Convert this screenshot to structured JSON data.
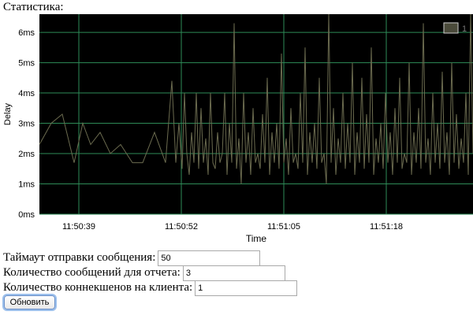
{
  "page": {
    "heading": "Статистика:"
  },
  "form": {
    "timeout_label": "Таймаут отправки сообщения:",
    "timeout_value": "50",
    "report_count_label": "Количество сообщений для отчета:",
    "report_count_value": "3",
    "connections_label": "Количество коннекшенов на клиента:",
    "connections_value": "1",
    "refresh_label": "Обновить"
  },
  "colors": {
    "plot_background": "#000000",
    "grid": "#2e8b57",
    "series_line": "#6b6b4f",
    "legend_swatch": "#4a4a3a",
    "button_focus": "#9cc0ec"
  },
  "chart_data": {
    "type": "line",
    "title": "",
    "xlabel": "Time",
    "ylabel": "Delay",
    "y_ticks": [
      "0ms",
      "1ms",
      "2ms",
      "3ms",
      "4ms",
      "5ms",
      "6ms"
    ],
    "ylim": [
      0,
      6.6
    ],
    "y_unit": "ms",
    "x_ticks": [
      "11:50:39",
      "11:50:52",
      "11:51:05",
      "11:51:18"
    ],
    "x_tick_seconds": [
      39,
      52,
      65,
      78
    ],
    "xlim_seconds": [
      34,
      89
    ],
    "grid": true,
    "legend_position": "top-right",
    "series": [
      {
        "name": "1",
        "x_seconds": [
          34.0,
          35.5,
          36.9,
          38.4,
          39.5,
          40.5,
          41.7,
          43.0,
          44.3,
          45.8,
          47.1,
          48.6,
          50.0,
          50.8,
          51.3,
          51.7,
          52.1,
          52.4,
          52.7,
          53.0,
          53.3,
          53.6,
          53.9,
          54.2,
          54.5,
          54.8,
          55.1,
          55.4,
          55.7,
          56.0,
          56.3,
          56.6,
          56.9,
          57.2,
          57.5,
          57.8,
          58.1,
          58.4,
          58.7,
          59.0,
          59.3,
          59.6,
          59.9,
          60.2,
          60.5,
          60.8,
          61.1,
          61.4,
          61.7,
          62.0,
          62.3,
          62.6,
          62.9,
          63.2,
          63.5,
          63.8,
          64.1,
          64.4,
          64.7,
          65.0,
          65.3,
          65.6,
          65.9,
          66.2,
          66.5,
          66.8,
          67.1,
          67.4,
          67.7,
          68.0,
          68.3,
          68.6,
          68.9,
          69.2,
          69.5,
          69.8,
          70.1,
          70.4,
          70.7,
          71.0,
          71.3,
          71.6,
          71.9,
          72.2,
          72.5,
          72.8,
          73.1,
          73.4,
          73.7,
          74.0,
          74.3,
          74.6,
          74.9,
          75.2,
          75.5,
          75.8,
          76.1,
          76.4,
          76.7,
          77.0,
          77.3,
          77.6,
          77.9,
          78.2,
          78.5,
          78.8,
          79.1,
          79.4,
          79.7,
          80.0,
          80.3,
          80.6,
          80.9,
          81.2,
          81.5,
          81.8,
          82.1,
          82.4,
          82.7,
          83.0,
          83.3,
          83.6,
          83.9,
          84.2,
          84.5,
          84.8,
          85.1,
          85.4,
          85.7,
          86.0,
          86.3,
          86.6,
          86.9,
          87.2,
          87.5,
          87.8,
          88.1,
          88.4,
          88.7,
          89.0
        ],
        "values": [
          2.3,
          3.0,
          3.3,
          1.7,
          3.0,
          2.3,
          2.7,
          2.0,
          2.3,
          1.7,
          1.7,
          2.7,
          1.7,
          4.4,
          1.7,
          3.0,
          1.5,
          4.0,
          2.0,
          1.3,
          2.7,
          1.7,
          4.0,
          1.5,
          3.5,
          1.7,
          2.5,
          1.3,
          4.0,
          1.7,
          1.5,
          2.7,
          1.7,
          2.0,
          4.0,
          1.3,
          3.0,
          1.7,
          6.3,
          1.5,
          2.5,
          1.0,
          4.0,
          1.7,
          2.7,
          1.3,
          3.5,
          1.7,
          2.0,
          1.5,
          3.3,
          1.7,
          4.5,
          1.3,
          2.7,
          1.7,
          3.0,
          1.5,
          5.3,
          1.7,
          2.5,
          1.3,
          3.5,
          1.7,
          2.0,
          1.5,
          4.0,
          1.7,
          5.5,
          1.3,
          2.7,
          1.7,
          3.0,
          1.5,
          4.5,
          1.7,
          2.0,
          1.0,
          6.8,
          1.7,
          3.5,
          1.3,
          2.5,
          1.7,
          4.0,
          1.5,
          3.0,
          1.7,
          5.0,
          1.3,
          2.7,
          1.7,
          4.5,
          1.5,
          3.3,
          1.7,
          5.5,
          1.3,
          2.5,
          1.7,
          3.0,
          1.5,
          4.0,
          1.7,
          2.7,
          1.3,
          3.5,
          1.7,
          4.5,
          1.5,
          2.0,
          1.7,
          5.0,
          1.3,
          2.7,
          1.7,
          3.5,
          1.5,
          6.3,
          1.7,
          2.5,
          1.3,
          4.0,
          1.7,
          3.0,
          1.5,
          4.7,
          1.7,
          2.7,
          1.3,
          5.0,
          1.7,
          3.3,
          1.5,
          2.5,
          1.7,
          4.0,
          1.3,
          6.8,
          2.0
        ]
      }
    ]
  }
}
